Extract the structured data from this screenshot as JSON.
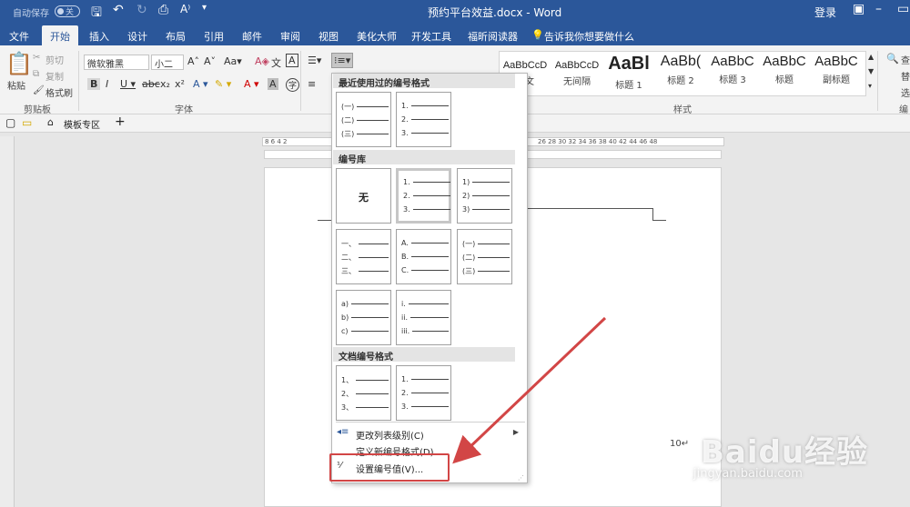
{
  "titlebar": {
    "autosave": "自动保存",
    "autosave_state": "关",
    "doc_title": "预约平台效益.docx  -  Word",
    "login": "登录"
  },
  "tabs": [
    "文件",
    "开始",
    "插入",
    "设计",
    "布局",
    "引用",
    "邮件",
    "审阅",
    "视图",
    "美化大师",
    "开发工具",
    "福昕阅读器"
  ],
  "active_tab": "开始",
  "tell_me": "告诉我你想要做什么",
  "ribbon": {
    "paste": "粘贴",
    "cut": "剪切",
    "copy": "复制",
    "format_painter": "格式刷",
    "clipboard_group": "剪贴板",
    "font_name": "微软雅黑",
    "font_size": "小二",
    "font_group": "字体",
    "styles_group": "样式",
    "style_items": [
      {
        "sample": "AaBbCcD",
        "name": "正文"
      },
      {
        "sample": "AaBbCcD",
        "name": "无间隔"
      },
      {
        "sample": "AaBl",
        "name": "标题 1"
      },
      {
        "sample": "AaBb(",
        "name": "标题 2"
      },
      {
        "sample": "AaBbC",
        "name": "标题 3"
      },
      {
        "sample": "AaBbC",
        "name": "标题"
      },
      {
        "sample": "AaBbC",
        "name": "副标题"
      }
    ],
    "right_cut": [
      "查",
      "替",
      "选"
    ],
    "right_label": "编"
  },
  "doctabs": {
    "template": "模板专区",
    "plus": "+"
  },
  "ruler_left": "8  6  4  2",
  "ruler_right": "26  28  30  32  34  36  38  40  42  44  46  48",
  "dropdown": {
    "recent_header": "最近使用过的编号格式",
    "library_header": "编号库",
    "doc_header": "文档编号格式",
    "none_label": "无",
    "recent": [
      [
        "(一)",
        "(二)",
        "(三)"
      ],
      [
        "1.",
        "2.",
        "3."
      ]
    ],
    "library": [
      [
        "1.",
        "2.",
        "3."
      ],
      [
        "1)",
        "2)",
        "3)"
      ],
      [
        "一、",
        "二、",
        "三、"
      ],
      [
        "A.",
        "B.",
        "C."
      ],
      [
        "(一)",
        "(二)",
        "(三)"
      ],
      [
        "a)",
        "b)",
        "c)"
      ],
      [
        "i.",
        "ii.",
        "iii."
      ]
    ],
    "document": [
      [
        "1、",
        "2、",
        "3、"
      ],
      [
        "1.",
        "2.",
        "3."
      ]
    ],
    "menu": [
      {
        "label": "更改列表级别(C)",
        "icon": "◂≡"
      },
      {
        "label": "定义新编号格式(D)...",
        "icon": ""
      },
      {
        "label": "设置编号值(V)...",
        "icon": "⅟"
      }
    ]
  },
  "page_text": "10↵",
  "watermark": {
    "main": "Baidu经验",
    "sub": "jingyan.baidu.com"
  },
  "colors": {
    "accent": "#2b579a",
    "highlight": "#d24646"
  }
}
